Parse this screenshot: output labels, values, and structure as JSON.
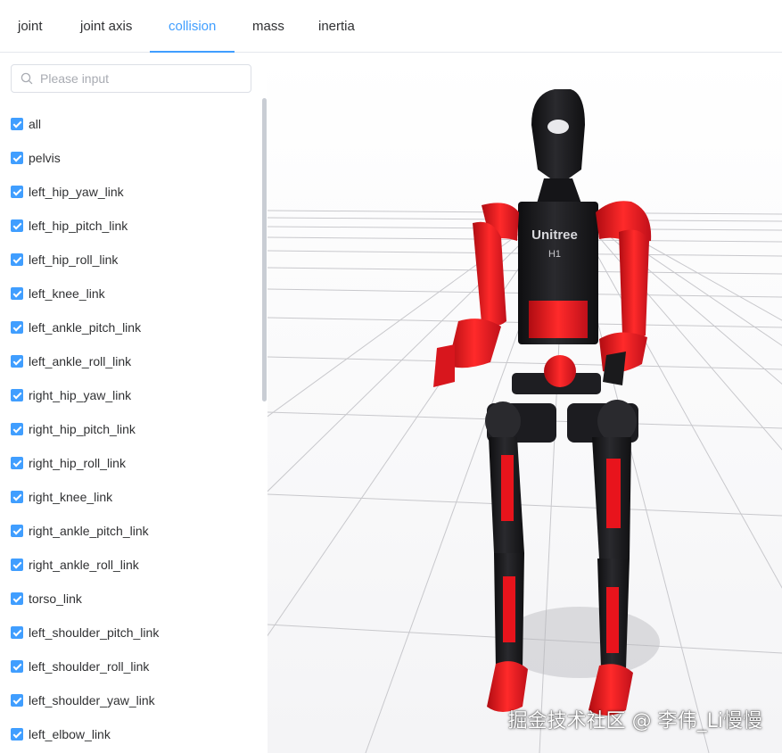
{
  "tabs": [
    {
      "label": "joint"
    },
    {
      "label": "joint axis"
    },
    {
      "label": "collision"
    },
    {
      "label": "mass"
    },
    {
      "label": "inertia"
    }
  ],
  "active_tab": "collision",
  "search": {
    "placeholder": "Please input",
    "value": ""
  },
  "links": [
    {
      "label": "all",
      "checked": true
    },
    {
      "label": "pelvis",
      "checked": true
    },
    {
      "label": "left_hip_yaw_link",
      "checked": true
    },
    {
      "label": "left_hip_pitch_link",
      "checked": true
    },
    {
      "label": "left_hip_roll_link",
      "checked": true
    },
    {
      "label": "left_knee_link",
      "checked": true
    },
    {
      "label": "left_ankle_pitch_link",
      "checked": true
    },
    {
      "label": "left_ankle_roll_link",
      "checked": true
    },
    {
      "label": "right_hip_yaw_link",
      "checked": true
    },
    {
      "label": "right_hip_pitch_link",
      "checked": true
    },
    {
      "label": "right_hip_roll_link",
      "checked": true
    },
    {
      "label": "right_knee_link",
      "checked": true
    },
    {
      "label": "right_ankle_pitch_link",
      "checked": true
    },
    {
      "label": "right_ankle_roll_link",
      "checked": true
    },
    {
      "label": "torso_link",
      "checked": true
    },
    {
      "label": "left_shoulder_pitch_link",
      "checked": true
    },
    {
      "label": "left_shoulder_roll_link",
      "checked": true
    },
    {
      "label": "left_shoulder_yaw_link",
      "checked": true
    },
    {
      "label": "left_elbow_link",
      "checked": true
    }
  ],
  "robot": {
    "brand": "Unitree",
    "model": "H1"
  },
  "watermark": "掘金技术社区 @ 李伟_Li慢慢",
  "colors": {
    "accent": "#409eff",
    "collision": "#e8141c",
    "robot_body": "#1c1c1e"
  }
}
